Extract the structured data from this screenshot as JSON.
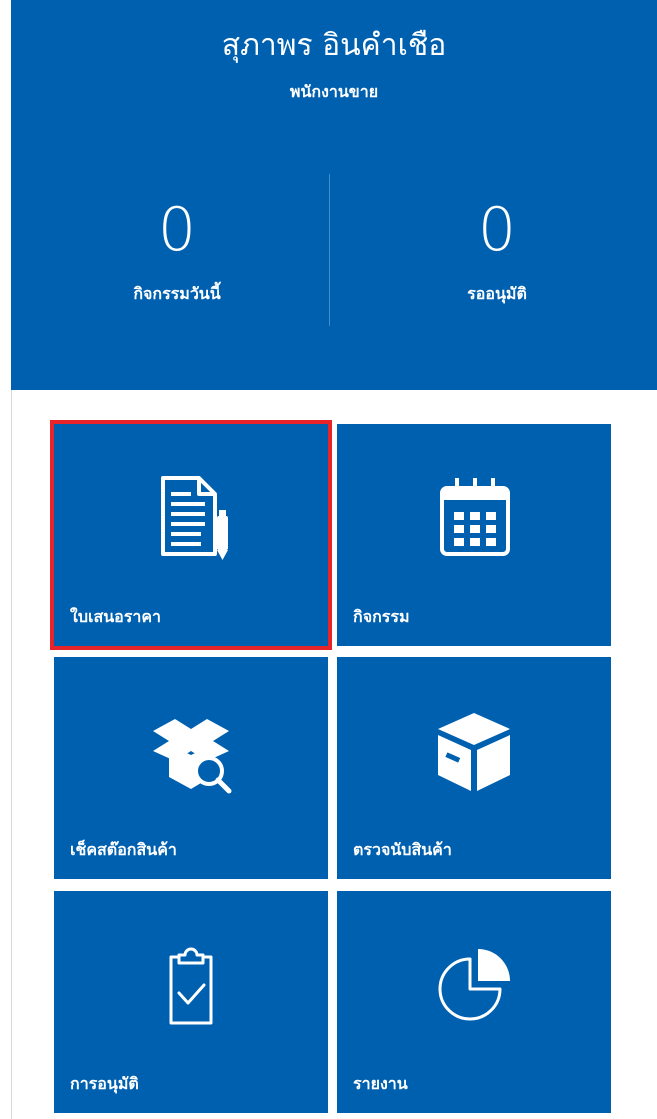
{
  "user": {
    "name": "สุภาพร อินคำเชือ",
    "role": "พนักงานขาย"
  },
  "stats": [
    {
      "value": "0",
      "label": "กิจกรรมวันนี้"
    },
    {
      "value": "0",
      "label": "รออนุมัติ"
    }
  ],
  "tiles": [
    {
      "label": "ใบเสนอราคา",
      "icon": "document-edit-icon",
      "selected": true
    },
    {
      "label": "กิจกรรม",
      "icon": "calendar-icon"
    },
    {
      "label": "เช็คสต๊อกสินค้า",
      "icon": "box-search-icon"
    },
    {
      "label": "ตรวจนับสินค้า",
      "icon": "box-icon"
    },
    {
      "label": "การอนุมัติ",
      "icon": "clipboard-check-icon"
    },
    {
      "label": "รายงาน",
      "icon": "pie-chart-icon"
    }
  ],
  "colors": {
    "primary": "#0060b0",
    "selected_outline": "#e8242b",
    "text": "#ffffff"
  }
}
